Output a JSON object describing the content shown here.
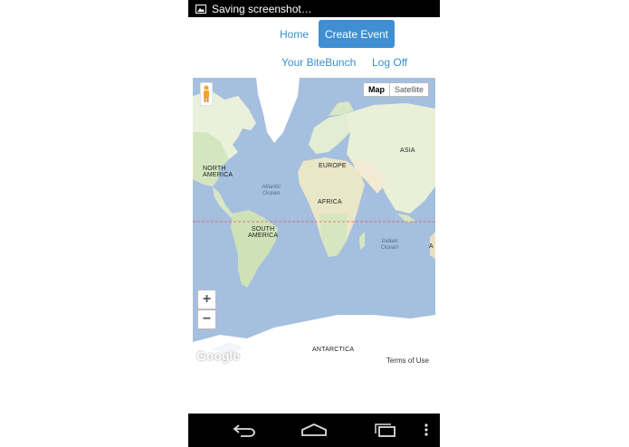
{
  "status_bar": {
    "notification_text": "Saving screenshot…",
    "icon": "image-icon"
  },
  "nav": {
    "home_label": "Home",
    "create_event_label": "Create Event",
    "bitebunch_label": "Your BiteBunch",
    "logoff_label": "Log Off",
    "accent_color": "#3f8fd2",
    "link_color": "#3a8fcf"
  },
  "map": {
    "type_toggle": {
      "map_label": "Map",
      "satellite_label": "Satellite",
      "selected": "Map"
    },
    "zoom_in_label": "+",
    "zoom_out_label": "−",
    "labels": {
      "north_america": "NORTH\nAMERICA",
      "europe": "EUROPE",
      "asia": "ASIA",
      "africa": "AFRICA",
      "south_america": "SOUTH\nAMERICA",
      "antarctica": "ANTARCTICA",
      "atlantic": "Atlantic\nOcean",
      "indian": "Indian\nOcean",
      "australia_partial": "A"
    },
    "logo": "Google",
    "terms": "Terms of Use",
    "equator": "dashed-red-line",
    "pegman": "pegman-icon"
  },
  "system_nav": {
    "back": "back-icon",
    "home": "home-icon",
    "recents": "recents-icon",
    "overflow": "overflow-menu-icon"
  }
}
